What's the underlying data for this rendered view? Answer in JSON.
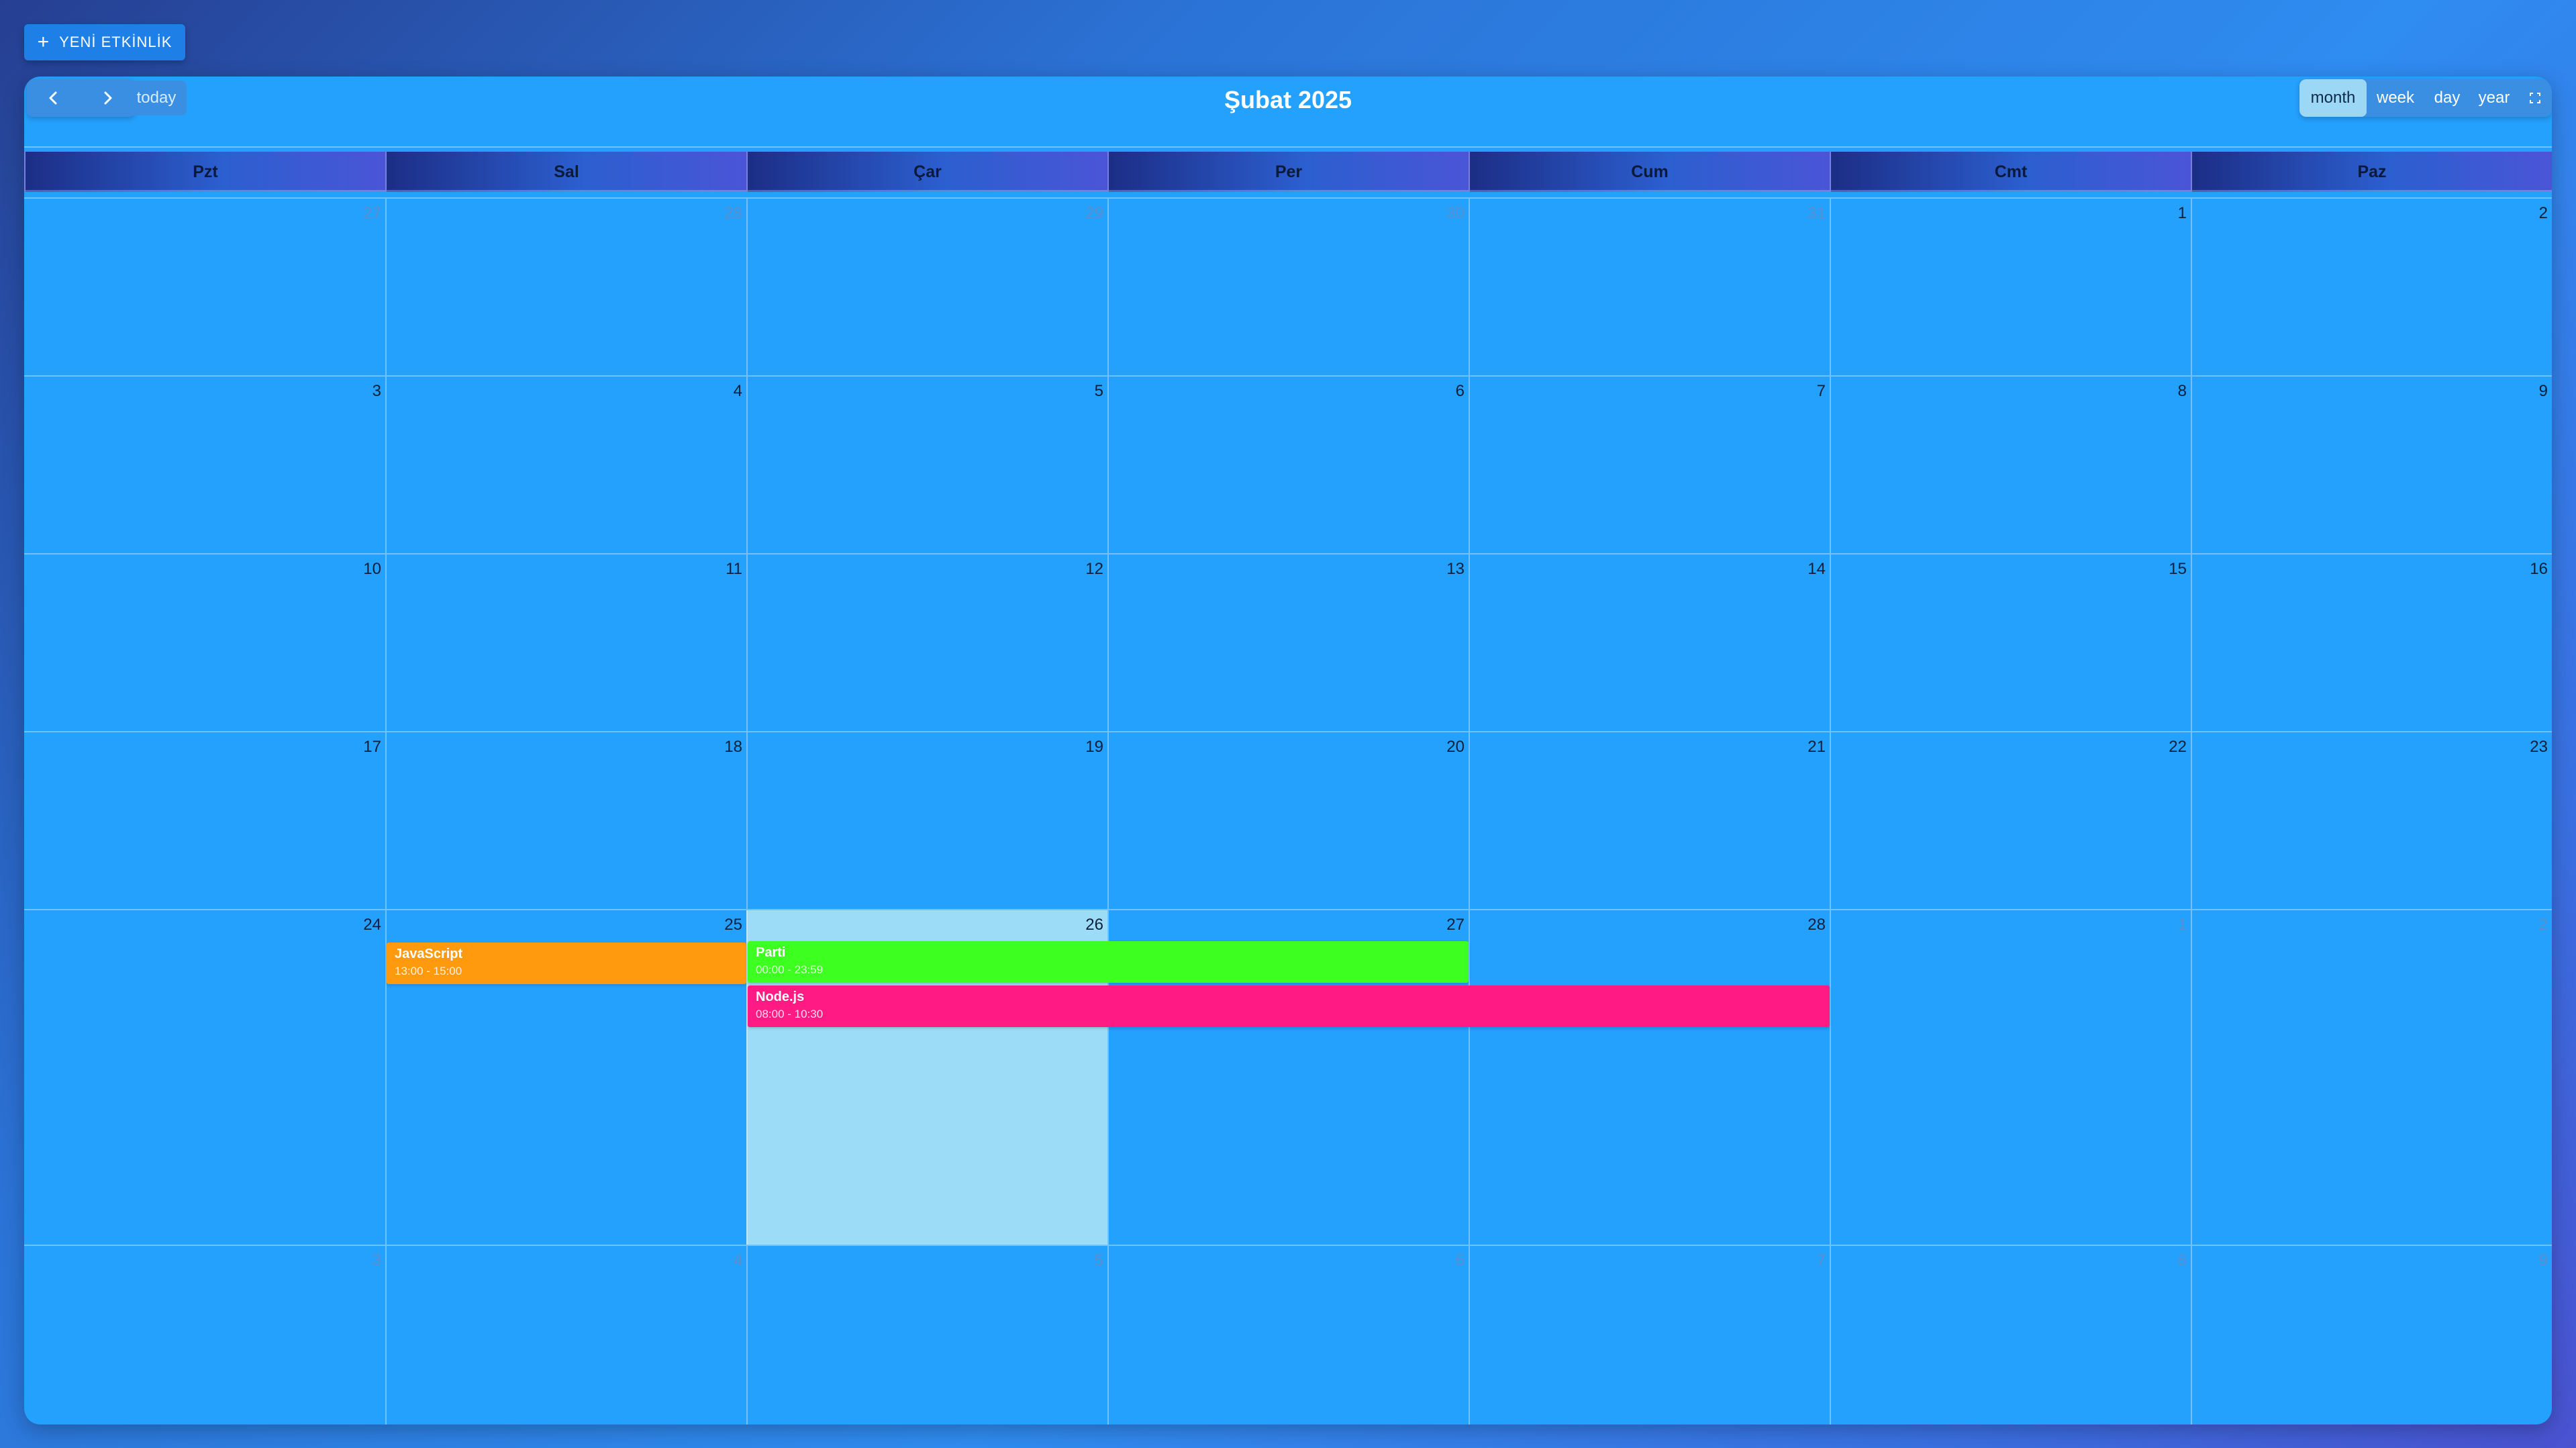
{
  "new_event_label": "YENİ ETKİNLİK",
  "toolbar": {
    "today_label": "today",
    "title": "Şubat 2025",
    "views": [
      {
        "label": "month",
        "active": true
      },
      {
        "label": "week",
        "active": false
      },
      {
        "label": "day",
        "active": false
      },
      {
        "label": "year",
        "active": false
      }
    ]
  },
  "weekdays": [
    "Pzt",
    "Sal",
    "Çar",
    "Per",
    "Cum",
    "Cmt",
    "Paz"
  ],
  "weeks": [
    [
      {
        "n": "27",
        "other": true
      },
      {
        "n": "28",
        "other": true
      },
      {
        "n": "29",
        "other": true
      },
      {
        "n": "30",
        "other": true
      },
      {
        "n": "31",
        "other": true
      },
      {
        "n": "1"
      },
      {
        "n": "2"
      }
    ],
    [
      {
        "n": "3"
      },
      {
        "n": "4"
      },
      {
        "n": "5"
      },
      {
        "n": "6"
      },
      {
        "n": "7"
      },
      {
        "n": "8"
      },
      {
        "n": "9"
      }
    ],
    [
      {
        "n": "10"
      },
      {
        "n": "11"
      },
      {
        "n": "12"
      },
      {
        "n": "13"
      },
      {
        "n": "14"
      },
      {
        "n": "15"
      },
      {
        "n": "16"
      }
    ],
    [
      {
        "n": "17"
      },
      {
        "n": "18"
      },
      {
        "n": "19"
      },
      {
        "n": "20"
      },
      {
        "n": "21"
      },
      {
        "n": "22"
      },
      {
        "n": "23"
      }
    ],
    [
      {
        "n": "24"
      },
      {
        "n": "25"
      },
      {
        "n": "26",
        "today": true
      },
      {
        "n": "27"
      },
      {
        "n": "28"
      },
      {
        "n": "1",
        "other": true
      },
      {
        "n": "2",
        "other": true
      }
    ],
    [
      {
        "n": "3",
        "other": true
      },
      {
        "n": "4",
        "other": true
      },
      {
        "n": "5",
        "other": true
      },
      {
        "n": "6",
        "other": true
      },
      {
        "n": "7",
        "other": true
      },
      {
        "n": "8",
        "other": true
      },
      {
        "n": "9",
        "other": true
      }
    ]
  ],
  "events": [
    {
      "title": "JavaScript",
      "time": "13:00 - 15:00",
      "color": "#ff9a0f",
      "start_day": "25"
    },
    {
      "title": "Parti",
      "time": "00:00 - 23:59",
      "color": "#3dff20",
      "start_day": "26"
    },
    {
      "title": "Node.js",
      "time": "08:00 - 10:30",
      "color": "#ff1a84",
      "start_day": "26"
    }
  ],
  "colors": {
    "calendar_bg": "#24a0fd",
    "today_cell": "#9ddcf6",
    "other_month_text": "#5a8fcf"
  }
}
